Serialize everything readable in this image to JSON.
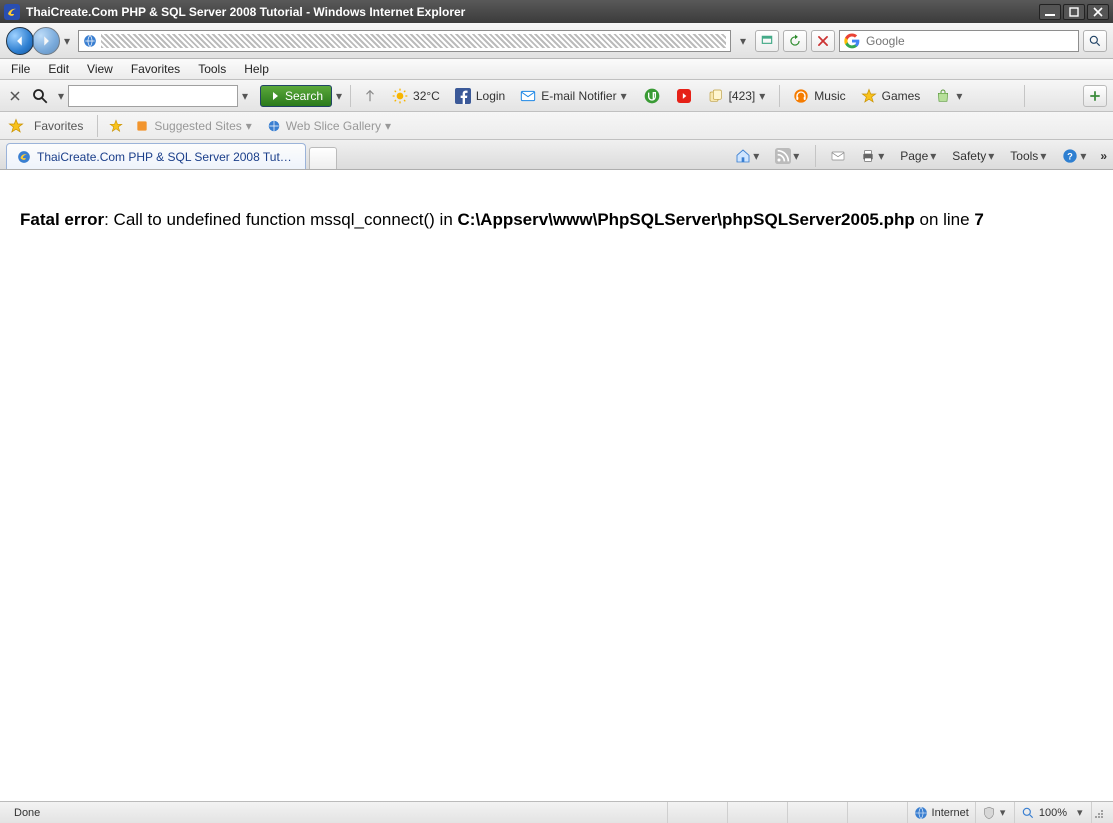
{
  "titlebar": {
    "title": "ThaiCreate.Com PHP & SQL Server 2008 Tutorial - Windows Internet Explorer"
  },
  "navrow": {
    "search_placeholder": "Google"
  },
  "menubar": {
    "items": [
      "File",
      "Edit",
      "View",
      "Favorites",
      "Tools",
      "Help"
    ]
  },
  "toolbar": {
    "search_label": "Search",
    "temp_label": "32°C",
    "login_label": "Login",
    "email_label": "E-mail Notifier",
    "count_label": "[423]",
    "music_label": "Music",
    "games_label": "Games"
  },
  "favbar": {
    "favorites_label": "Favorites",
    "suggested_label": "Suggested Sites",
    "webslice_label": "Web Slice Gallery"
  },
  "tab": {
    "label": "ThaiCreate.Com PHP & SQL Server 2008 Tutorial"
  },
  "tabright": {
    "page_label": "Page",
    "safety_label": "Safety",
    "tools_label": "Tools"
  },
  "content": {
    "err_head": "Fatal error",
    "err_mid": ": Call to undefined function mssql_connect() in ",
    "err_path": "C:\\Appserv\\www\\PhpSQLServer\\phpSQLServer2005.php",
    "err_online": " on line ",
    "err_line": "7"
  },
  "statusbar": {
    "done": "Done",
    "zone": "Internet",
    "zoom": "100%"
  }
}
